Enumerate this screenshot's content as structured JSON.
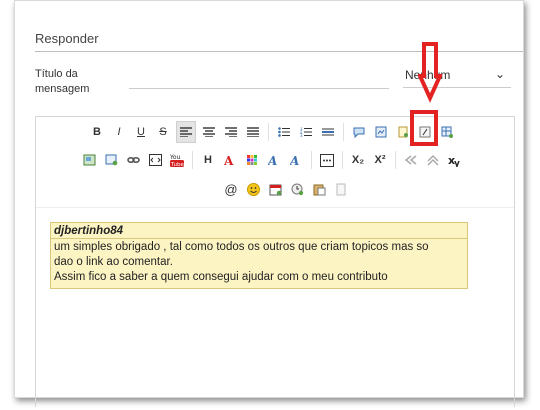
{
  "section": {
    "heading": "Responder"
  },
  "form": {
    "title_label": "Título da mensagem",
    "icon_select_value": "Nenhum"
  },
  "toolbar": {
    "row1": [
      "bold-icon",
      "italic-icon",
      "underline-icon",
      "strikethrough-icon",
      "align-left-icon",
      "align-center-icon",
      "align-right-icon",
      "align-justify-icon",
      "bullet-list-icon",
      "numbered-list-icon",
      "horizontal-rule-icon",
      "speech-bubble-icon",
      "image-doc-icon",
      "document-icon",
      "spoiler-icon",
      "table-icon"
    ],
    "bold": "B",
    "italic": "I",
    "underline": "U",
    "strike": "S",
    "heading": "H",
    "subscript": "X₂",
    "superscript": "X²",
    "mention": "@",
    "youtube": "You"
  },
  "quote": {
    "author": "djbertinho84",
    "lines": [
      "um simples obrigado , tal como todos os outros que criam topicos mas so",
      "dao o link ao comentar.",
      "Assim fico a saber a quem consegui ajudar com o meu contributo"
    ]
  },
  "colors": {
    "annotation_red": "#e32222",
    "quote_bg": "#fdf4c4"
  }
}
